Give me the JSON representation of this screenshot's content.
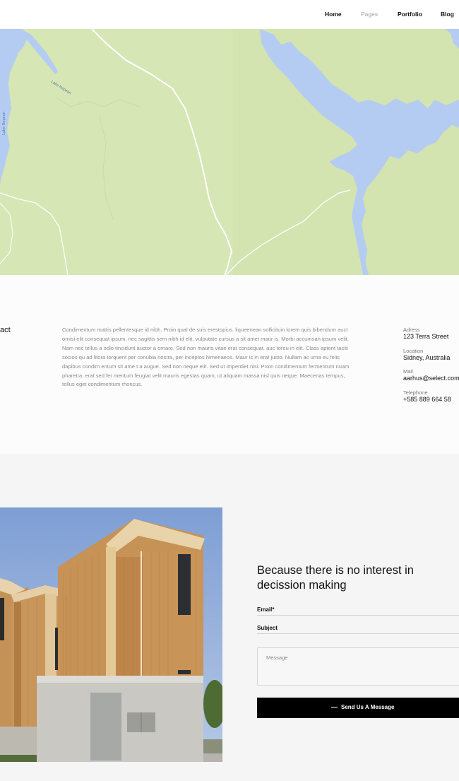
{
  "nav": {
    "items": [
      {
        "label": "Home"
      },
      {
        "label": "Pages"
      },
      {
        "label": "Portfolio"
      },
      {
        "label": "Blog"
      }
    ]
  },
  "map": {
    "labels": [
      "Lake Nepean",
      "Lake Nepean"
    ],
    "colors": {
      "land": "#d6e6b5",
      "water": "#b5ccf2",
      "road": "#ffffff"
    }
  },
  "contact": {
    "heading": "act",
    "paragraph_lines": [
      "Condimentum mattis pellentesque id nibh. Proin qual de suis erestopius. liqueenean sollicituin lorem quis bibendum auct",
      "ornisi elit consequat ipsum, nec sagittis sem nibh id elit. vulputate cursus a sit amet maur is. Morbi accumsan ipsum velit.",
      "Nam nec tellus a odio tincidunt auctor a ornare. Sed non mauris vitae erat consequat. auc toreu in elit. Class aptent taciti",
      "socios qu ad litora torquent per conubia nostra, per inceptos himenaeos. Maur is in erat justo. Nullam ac urna eu felis",
      "dapibus condim entum sit ame t a augue. Sed non neque elit. Sed ut imperdiet nisi. Proin condimentum fermentum nuam",
      "pharetra, erat sed fer mentum feugiat velit mauris egestas quam, ut aliquam massa nisl quis neque. Maecenas tempus,",
      "tellus eget condimentum rhoncus."
    ],
    "details": [
      {
        "label": "Adress",
        "value": "123 Terra Street"
      },
      {
        "label": "Location",
        "value": "Sidney, Australia"
      },
      {
        "label": "Mail",
        "value": "aarhus@select.com"
      },
      {
        "label": "Telephone",
        "value": "+585 889 664 58"
      }
    ]
  },
  "form": {
    "title": "Because there is no interest in decission making",
    "email_label": "Email*",
    "subject_label": "Subject",
    "message_placeholder": "Message",
    "button_label": "Send Us A Message"
  }
}
